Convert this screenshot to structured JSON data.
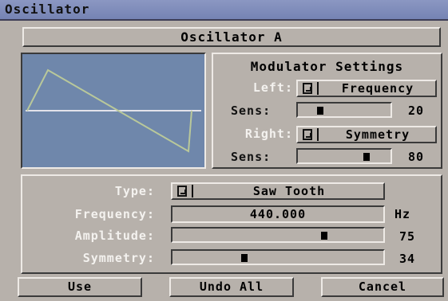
{
  "window": {
    "title": "Oscillator"
  },
  "header": {
    "name": "Oscillator A"
  },
  "waveform": {
    "colors": {
      "background": "#6f87ab",
      "wave": "#b9c89a",
      "axis": "#e2e2ea"
    }
  },
  "modulator": {
    "title": "Modulator Settings",
    "left_label": "Left:",
    "left_value": "Frequency",
    "left_sens_label": "Sens:",
    "left_sens": "20",
    "right_label": "Right:",
    "right_value": "Symmetry",
    "right_sens_label": "Sens:",
    "right_sens": "80"
  },
  "params": {
    "type_label": "Type:",
    "type_value": "Saw Tooth",
    "frequency_label": "Frequency:",
    "frequency_value": "440.000",
    "frequency_unit": "Hz",
    "amplitude_label": "Amplitude:",
    "amplitude_value": "75",
    "symmetry_label": "Symmetry:",
    "symmetry_value": "34"
  },
  "buttons": {
    "use": "Use",
    "undo_all": "Undo All",
    "cancel": "Cancel"
  }
}
